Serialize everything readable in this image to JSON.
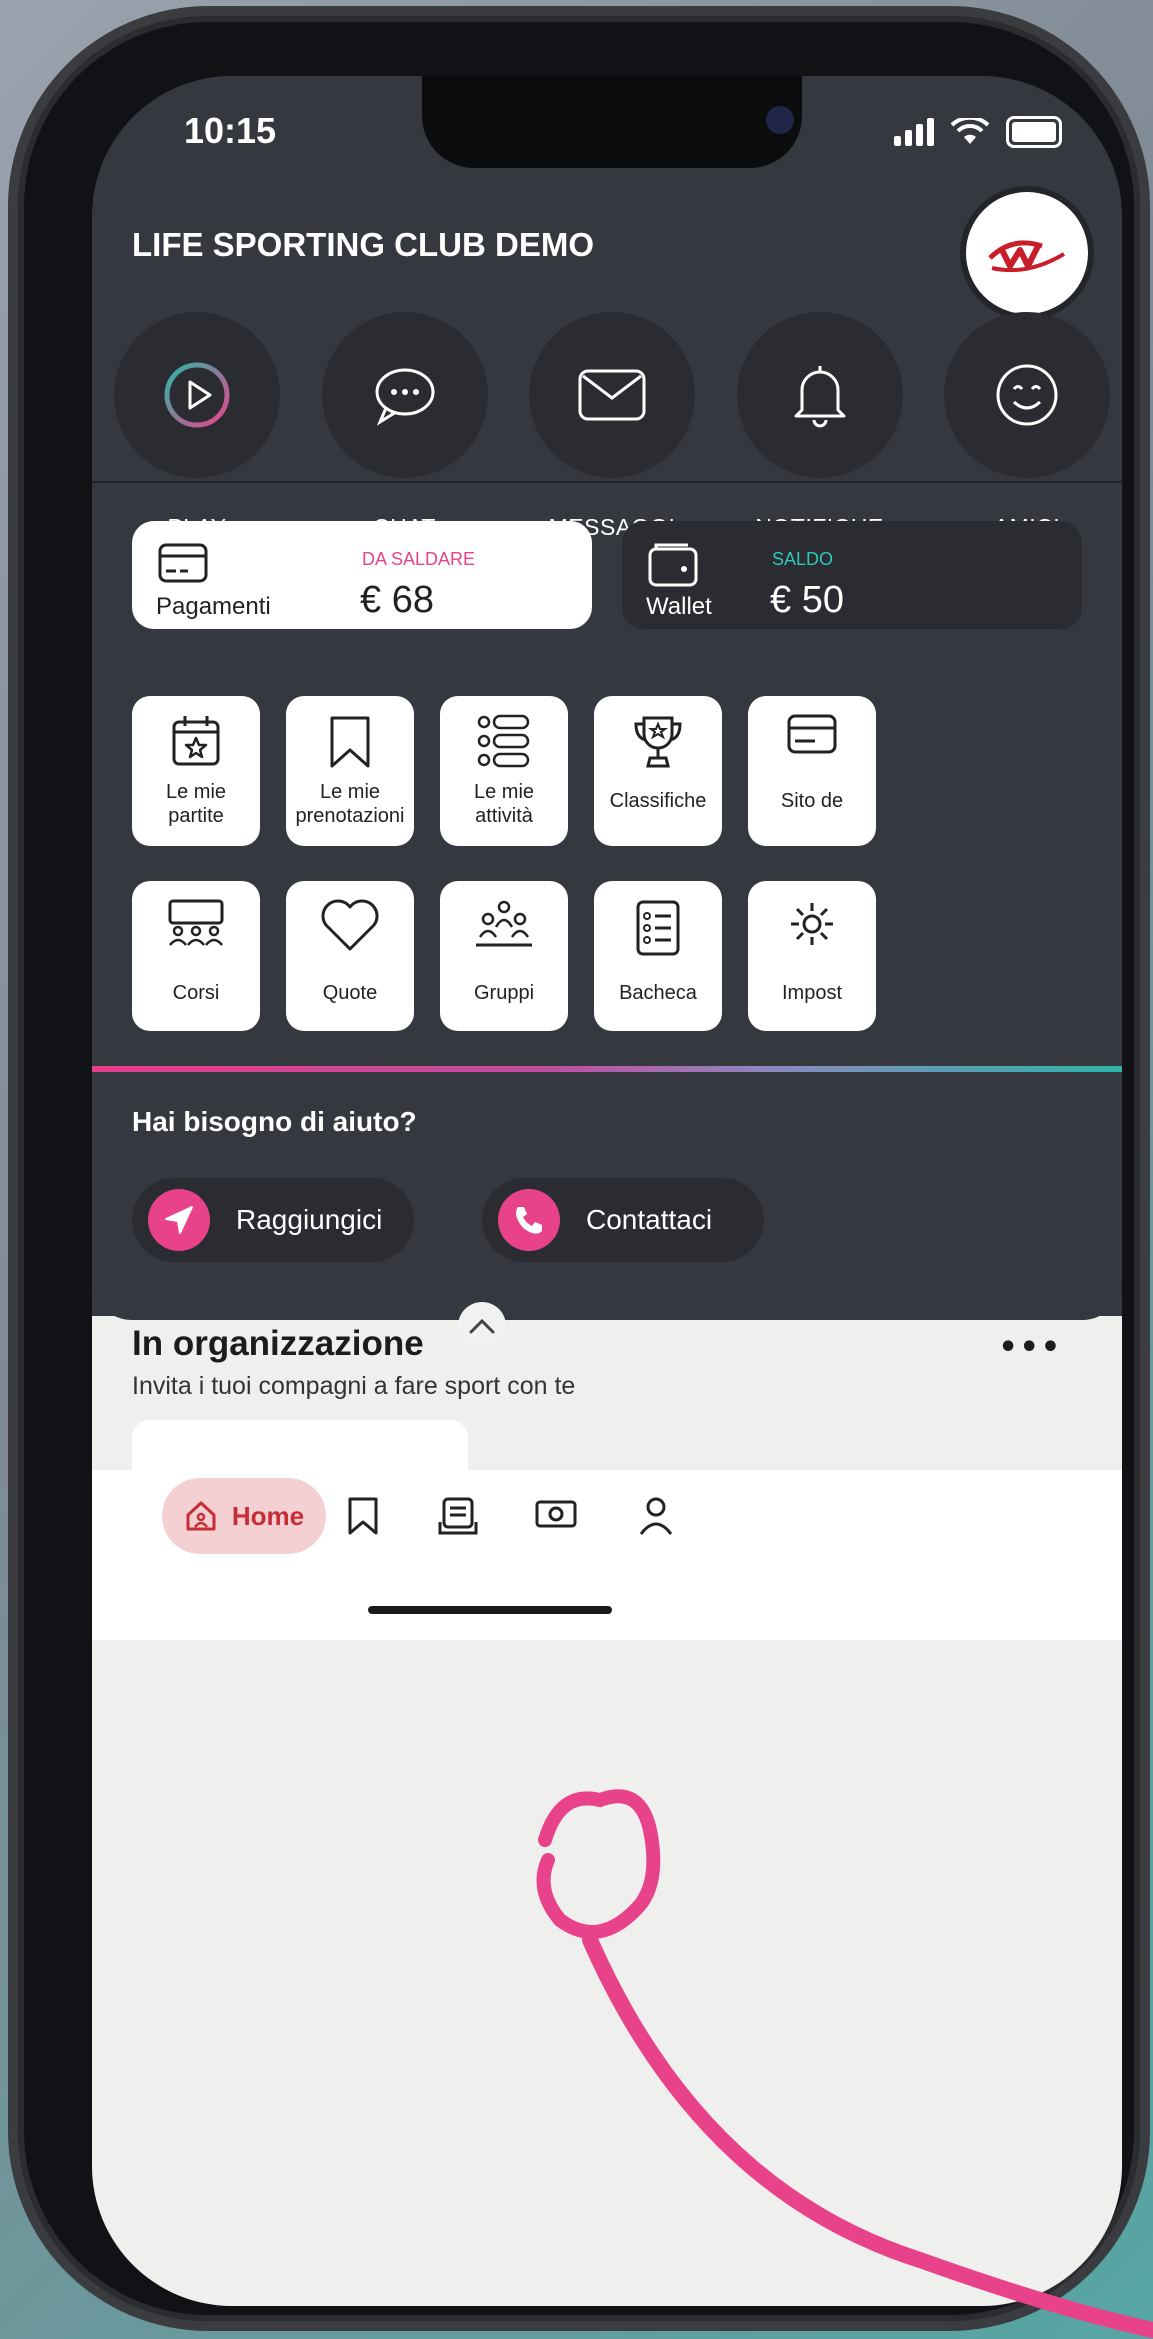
{
  "status_bar": {
    "time": "10:15"
  },
  "header": {
    "title": "LIFE SPORTING CLUB DEMO",
    "logo_icon": "club-logo"
  },
  "quick_actions": [
    {
      "label": "PLAY",
      "icon": "play-icon"
    },
    {
      "label": "CHAT",
      "icon": "chat-icon"
    },
    {
      "label": "MESSAGGI",
      "icon": "mail-icon"
    },
    {
      "label": "NOTIFICHE",
      "icon": "bell-icon"
    },
    {
      "label": "AMICI",
      "icon": "smile-icon"
    }
  ],
  "payments": {
    "name": "Pagamenti",
    "tag": "DA SALDARE",
    "amount": "€ 68",
    "tag_color": "#e8438a"
  },
  "wallet": {
    "name": "Wallet",
    "tag": "SALDO",
    "amount": "€ 50",
    "tag_color": "#2cc9b6"
  },
  "tiles_row1": [
    {
      "label": "Le mie\npartite",
      "icon": "calendar-star-icon"
    },
    {
      "label": "Le mie\nprenotazioni",
      "icon": "bookmark-icon"
    },
    {
      "label": "Le mie\nattività",
      "icon": "list-icon"
    },
    {
      "label": "Classifiche",
      "icon": "trophy-icon"
    },
    {
      "label": "Sito de",
      "icon": "card-icon"
    }
  ],
  "tiles_row2": [
    {
      "label": "Corsi",
      "icon": "class-icon"
    },
    {
      "label": "Quote",
      "icon": "heart-icon"
    },
    {
      "label": "Gruppi",
      "icon": "group-icon"
    },
    {
      "label": "Bacheca",
      "icon": "board-icon"
    },
    {
      "label": "Impost",
      "icon": "settings-icon"
    }
  ],
  "help": {
    "title": "Hai bisogno di aiuto?",
    "directions_label": "Raggiungici",
    "contact_label": "Contattaci"
  },
  "section": {
    "title": "In organizzazione",
    "more": "•••",
    "subtitle": "Invita i tuoi compagni a fare sport con te"
  },
  "nav": {
    "home_label": "Home"
  },
  "colors": {
    "accent": "#e8438a",
    "teal": "#2cb5a8",
    "dark_bg": "#35383f"
  }
}
